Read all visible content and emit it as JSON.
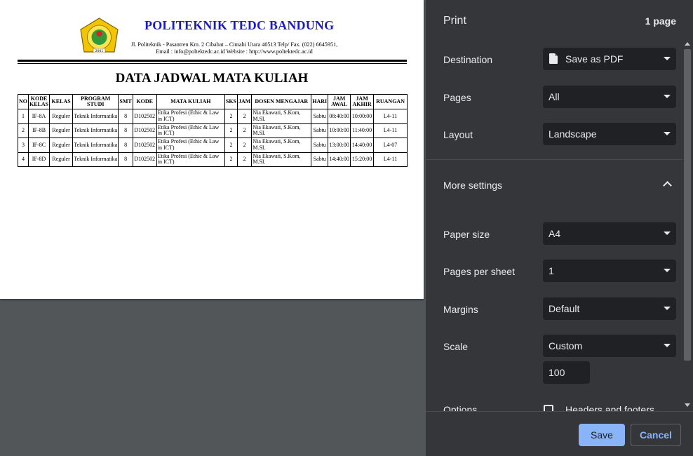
{
  "document": {
    "institution_name": "POLITEKNIK TEDC BANDUNG",
    "logo_text": "POLITEKNIK TEDC BANDUNG 2001",
    "address_line1": "Jl. Politeknik - Pasantren Km. 2 Cibabat – Cimahi Utara 40513 Telp/ Fax. (022) 6645951,",
    "address_line2": "Email : info@poltektedc.ac.id Website : http://www.poltektedc.ac.id",
    "title": "DATA JADWAL MATA KULIAH",
    "table": {
      "headers": [
        "NO",
        "KODE KELAS",
        "KELAS",
        "PROGRAM STUDI",
        "SMT",
        "KODE",
        "MATA KULIAH",
        "SKS",
        "JAM",
        "DOSEN MENGAJAR",
        "HARI",
        "JAM AWAL",
        "JAM AKHIR",
        "RUANGAN"
      ],
      "rows": [
        [
          "1",
          "IF-8A",
          "Reguler",
          "Teknik Informatika",
          "8",
          "D102502",
          "Etika Profesi (Ethic & Law in ICT)",
          "2",
          "2",
          "Nia Ekawati, S.Kom, M.SI.",
          "Sabtu",
          "08:40:00",
          "10:00:00",
          "L4-11"
        ],
        [
          "2",
          "IF-8B",
          "Reguler",
          "Teknik Informatika",
          "8",
          "D102502",
          "Etika Profesi (Ethic & Law in ICT)",
          "2",
          "2",
          "Nia Ekawati, S.Kom, M.SI.",
          "Sabtu",
          "10:00:00",
          "11:40:00",
          "L4-11"
        ],
        [
          "3",
          "IF-8C",
          "Reguler",
          "Teknik Informatika",
          "8",
          "D102502",
          "Etika Profesi (Ethic & Law in ICT)",
          "2",
          "2",
          "Nia Ekawati, S.Kom, M.SI.",
          "Sabtu",
          "13:00:00",
          "14:40:00",
          "L4-07"
        ],
        [
          "4",
          "IF-8D",
          "Reguler",
          "Teknik Informatika",
          "8",
          "D102502",
          "Etika Profesi (Ethic & Law in ICT)",
          "2",
          "2",
          "Nia Ekawati, S.Kom, M.SI.",
          "Sabtu",
          "14:40:00",
          "15:20:00",
          "L4-11"
        ]
      ]
    }
  },
  "print_panel": {
    "title": "Print",
    "page_count": "1 page",
    "destination": {
      "label": "Destination",
      "value": "Save as PDF",
      "icon": "file-icon"
    },
    "pages": {
      "label": "Pages",
      "value": "All"
    },
    "layout": {
      "label": "Layout",
      "value": "Landscape"
    },
    "more_settings": {
      "label": "More settings",
      "icon": "chevron-up-icon"
    },
    "paper_size": {
      "label": "Paper size",
      "value": "A4"
    },
    "pages_per_sheet": {
      "label": "Pages per sheet",
      "value": "1"
    },
    "margins": {
      "label": "Margins",
      "value": "Default"
    },
    "scale": {
      "label": "Scale",
      "value": "Custom",
      "input_value": "100"
    },
    "options": {
      "label": "Options",
      "headers_footers_label": "Headers and footers",
      "headers_footers_checked": false
    },
    "save_label": "Save",
    "cancel_label": "Cancel"
  },
  "colors": {
    "panel_bg": "#35363a",
    "field_bg": "#202124",
    "accent": "#8ab4f8",
    "preview_bg": "#525659",
    "institution_blue": "#1a1acc"
  }
}
